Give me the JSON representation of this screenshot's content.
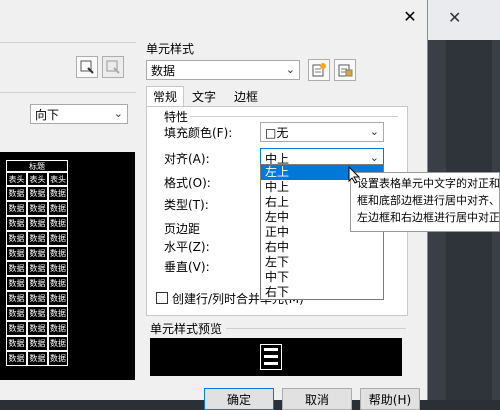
{
  "dialog": {
    "close_symbol": "✕",
    "left_dropdown_value": "向下",
    "cell_style": {
      "title": "单元样式",
      "value": "数据"
    },
    "tabs": [
      "常规",
      "文字",
      "边框"
    ],
    "properties": {
      "heading": "特性",
      "fill_color_label": "填充颜色(F):",
      "fill_color_value": "□无",
      "align_label": "对齐(A):",
      "align_value": "中上",
      "format_label": "格式(O):",
      "type_label": "类型(T):"
    },
    "margins": {
      "heading": "页边距",
      "horizontal_label": "水平(Z):",
      "vertical_label": "垂直(V):"
    },
    "merge_checkbox_label": "创建行/列时合并单元(M)",
    "preview_title": "单元样式预览",
    "align_options": [
      "左上",
      "中上",
      "右上",
      "左中",
      "正中",
      "右中",
      "左下",
      "中下",
      "右下"
    ],
    "align_selected": "左上",
    "tooltip_lines": [
      "设置表格单元中文字的对正和对齐方式",
      "框和底部边框进行居中对齐、上对齐或下对齐",
      "左边框和右边框进行居中对正、左对正或右对正"
    ],
    "bottom_buttons": [
      "确定",
      "取消",
      "帮助(H)"
    ],
    "table_preview": {
      "header": "标题",
      "head_cells": [
        "表头",
        "表头",
        "表头"
      ],
      "data_cell": "数据"
    }
  },
  "icon_names": [
    "close-icon",
    "new-style-icon",
    "manage-style-icon",
    "chevron-down-icon",
    "cursor-icon"
  ]
}
